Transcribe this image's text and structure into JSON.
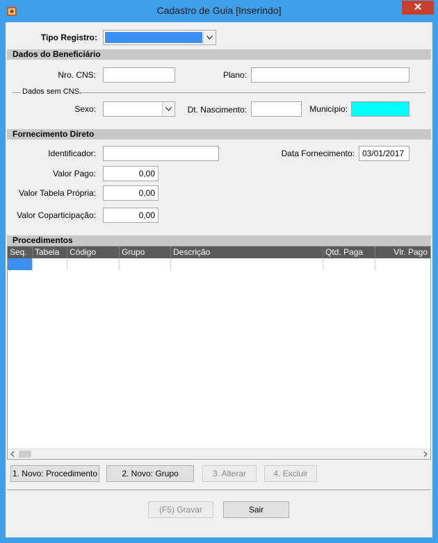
{
  "window": {
    "title": "Cadastro de Guia [Inserindo]",
    "close_label": "✕"
  },
  "form": {
    "tipo_registro_label": "Tipo Registro:",
    "tipo_registro_value": ""
  },
  "beneficiario": {
    "section_title": "Dados do Beneficiário",
    "nro_cns_label": "Nro. CNS:",
    "nro_cns_value": "",
    "plano_label": "Plano:",
    "plano_value": "",
    "sem_cns_label": "Dados sem CNS.",
    "sexo_label": "Sexo:",
    "sexo_value": "",
    "dt_nascimento_label": "Dt. Nascimento:",
    "dt_nascimento_value": "",
    "municipio_label": "Município:",
    "municipio_value": ""
  },
  "fornecimento": {
    "section_title": "Fornecimento Direto",
    "identificador_label": "Identificador:",
    "identificador_value": "",
    "data_fornecimento_label": "Data Fornecimento:",
    "data_fornecimento_value": "03/01/2017",
    "valor_pago_label": "Valor Pago:",
    "valor_pago_value": "0,00",
    "valor_tabela_label": "Valor Tabela Própria:",
    "valor_tabela_value": "0,00",
    "valor_coparticipacao_label": "Valor Coparticipação:",
    "valor_coparticipacao_value": "0,00"
  },
  "procedimentos": {
    "section_title": "Procedimentos",
    "columns": [
      "Seq.",
      "Tabela",
      "Código",
      "Grupo",
      "Descrição",
      "Qtd. Paga",
      "Vlr. Pago"
    ]
  },
  "buttons": {
    "novo_procedimento": "1. Novo: Procedimento",
    "novo_grupo": "2. Novo: Grupo",
    "alterar": "3. Alterar",
    "excluir": "4. Excluir",
    "gravar": "(F5)  Gravar",
    "sair": "Sair"
  },
  "colors": {
    "selection": "#3c8ff0",
    "municipio_bg": "#00ffff",
    "titlebar": "#3f9fe8",
    "close": "#c7402d"
  }
}
